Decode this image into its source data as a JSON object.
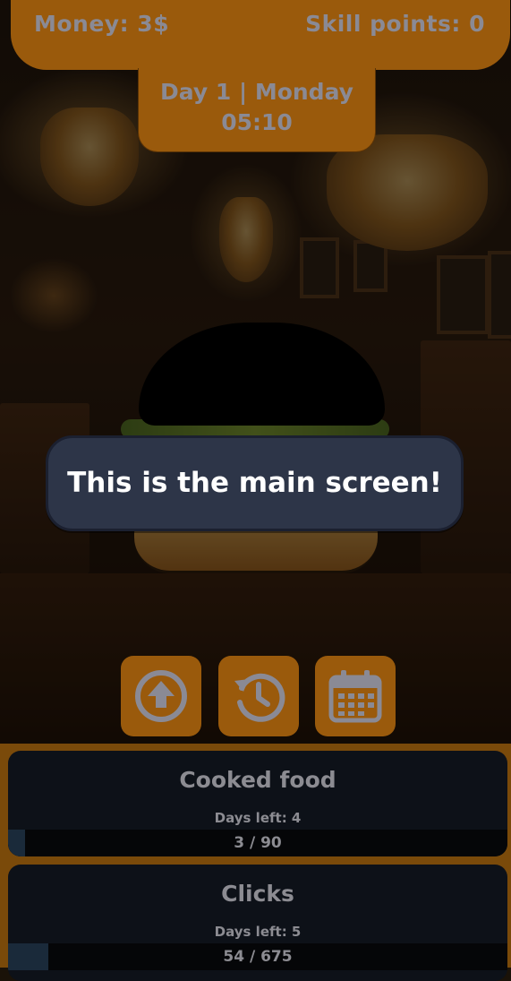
{
  "header": {
    "money": "Money: 3$",
    "skill_points": "Skill points: 0",
    "day": "Day 1 | Monday",
    "time": "05:10"
  },
  "tutorial": {
    "message": "This is the main screen!"
  },
  "actions": [
    {
      "icon": "upgrade-arrow-icon"
    },
    {
      "icon": "history-clock-icon"
    },
    {
      "icon": "calendar-icon"
    }
  ],
  "quests": [
    {
      "title": "Cooked food",
      "days_left": "Days left: 4",
      "progress_text": "3 / 90",
      "progress": 0.0333
    },
    {
      "title": "Clicks",
      "days_left": "Days left: 5",
      "progress_text": "54 / 675",
      "progress": 0.08
    }
  ],
  "colors": {
    "accent_orange": "#9a5a0c",
    "tooltip_bg": "#2d3548",
    "card_bg": "#0d1118",
    "muted_text": "#8a8a95"
  }
}
